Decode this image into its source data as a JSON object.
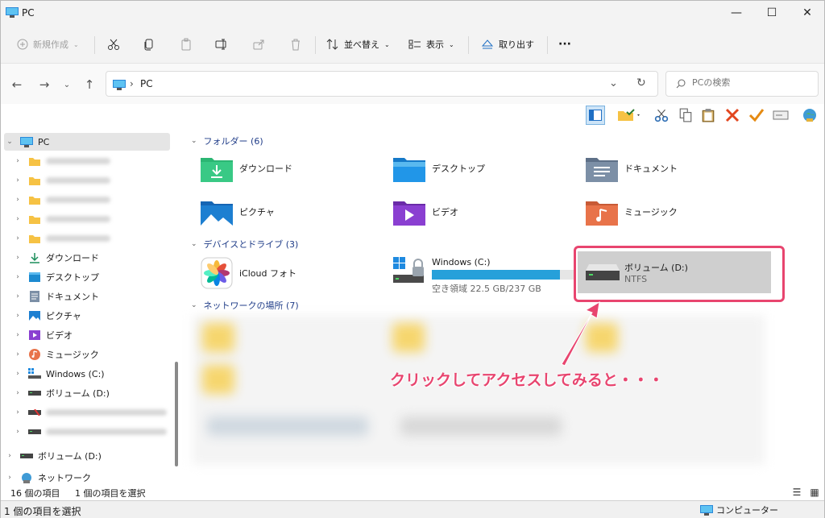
{
  "window": {
    "title": "PC",
    "minimize": "—",
    "maximize": "☐",
    "close": "✕"
  },
  "commandbar": {
    "new_label": "新規作成",
    "sort_label": "並べ替え",
    "view_label": "表示",
    "eject_label": "取り出す",
    "more_label": "···"
  },
  "address": {
    "crumb": "PC",
    "search_placeholder": "PCの検索"
  },
  "sidebar": {
    "root": "PC",
    "items": [
      {
        "label": "ダウンロード",
        "icon": "download-icon"
      },
      {
        "label": "デスクトップ",
        "icon": "desktop-folder-icon"
      },
      {
        "label": "ドキュメント",
        "icon": "documents-icon"
      },
      {
        "label": "ピクチャ",
        "icon": "pictures-icon"
      },
      {
        "label": "ビデオ",
        "icon": "videos-icon"
      },
      {
        "label": "ミュージック",
        "icon": "music-icon"
      },
      {
        "label": "Windows (C:)",
        "icon": "windows-drive-icon"
      },
      {
        "label": "ボリューム (D:)",
        "icon": "drive-icon"
      }
    ],
    "volume_d2": "ボリューム (D:)",
    "network": "ネットワーク"
  },
  "content": {
    "folders_header": "フォルダー (6)",
    "folders": [
      {
        "label": "ダウンロード"
      },
      {
        "label": "デスクトップ"
      },
      {
        "label": "ドキュメント"
      },
      {
        "label": "ピクチャ"
      },
      {
        "label": "ビデオ"
      },
      {
        "label": "ミュージック"
      }
    ],
    "devices_header": "デバイスとドライブ (3)",
    "icloud_label": "iCloud フォト",
    "drive_c": {
      "name": "Windows (C:)",
      "free_text": "空き領域 22.5 GB/237 GB",
      "used_fraction": 0.905
    },
    "drive_d": {
      "name": "ボリューム (D:)",
      "fs": "NTFS"
    },
    "network_header": "ネットワークの場所 (7)"
  },
  "annotation": {
    "text": "クリックしてアクセスしてみると・・・",
    "color": "#e8456f"
  },
  "status": {
    "item_count": "16 個の項目",
    "selected_count": "1 個の項目を選択",
    "bottom_left": "1 個の項目を選択",
    "bottom_right": "コンピューター"
  }
}
